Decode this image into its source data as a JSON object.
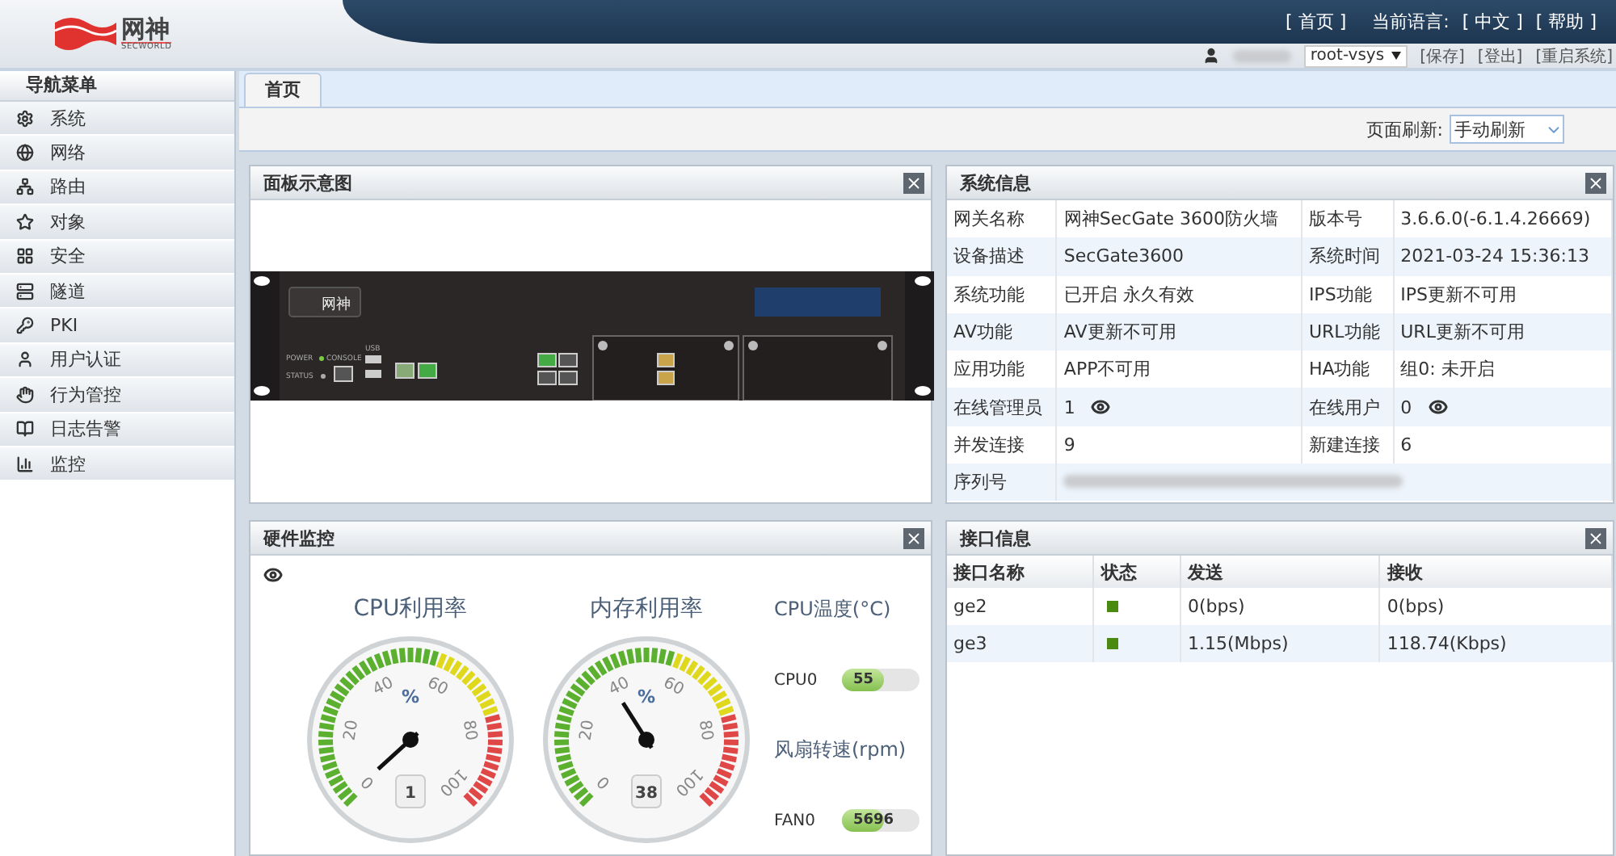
{
  "header": {
    "logo_text": "网神",
    "logo_subtext": "SECWORLD",
    "home_link": "[ 首页 ]",
    "language_label": "当前语言:",
    "language_link": "[ 中文 ]",
    "help_link": "[ 帮助 ]",
    "vsys": "root-vsys",
    "actions": [
      "[保存]",
      "[登出]",
      "[重启系统]"
    ]
  },
  "nav": {
    "title": "导航菜单",
    "items": [
      {
        "label": "系统"
      },
      {
        "label": "网络"
      },
      {
        "label": "路由"
      },
      {
        "label": "对象"
      },
      {
        "label": "安全"
      },
      {
        "label": "隧道"
      },
      {
        "label": "PKI"
      },
      {
        "label": "用户认证"
      },
      {
        "label": "行为管控"
      },
      {
        "label": "日志告警"
      },
      {
        "label": "监控"
      }
    ]
  },
  "tabs": [
    {
      "label": "首页",
      "selected": true
    }
  ],
  "refresh": {
    "label": "页面刷新:",
    "value": "手动刷新"
  },
  "panel_view": {
    "title": "面板示意图",
    "device_logo": "网神",
    "port_labels": [
      "POWER",
      "CONSOLE",
      "USB",
      "STATUS"
    ]
  },
  "system_info": {
    "title": "系统信息",
    "rows": [
      {
        "label": "网关名称",
        "value": "网神SecGate 3600防火墙",
        "label_2": "版本号",
        "value_2": "3.6.6.0(-6.1.4.26669)"
      },
      {
        "label": "设备描述",
        "value": "SecGate3600",
        "label_2": "系统时间",
        "value_2": "2021-03-24 15:36:13"
      },
      {
        "label": "系统功能",
        "value": "已开启 永久有效",
        "label_2": "IPS功能",
        "value_2": "IPS更新不可用"
      },
      {
        "label": "AV功能",
        "value": "AV更新不可用",
        "label_2": "URL功能",
        "value_2": "URL更新不可用"
      },
      {
        "label": "应用功能",
        "value": "APP不可用",
        "label_2": "HA功能",
        "value_2": "组0: 未开启"
      },
      {
        "label": "在线管理员",
        "value": "1",
        "kind": "viewable",
        "label_2": "在线用户",
        "value_2": "0"
      },
      {
        "label": "并发连接",
        "value": "9",
        "label_2": "新建连接",
        "value_2": "6"
      },
      {
        "label": "序列号",
        "kind": "redacted"
      }
    ]
  },
  "hardware": {
    "title": "硬件监控",
    "gauges": [
      {
        "title": "CPU利用率",
        "unit": "%",
        "scale": [
          "0",
          "20",
          "40",
          "60",
          "80",
          "100"
        ],
        "reading": "1"
      },
      {
        "title": "内存利用率",
        "unit": "%",
        "scale": [
          "0",
          "20",
          "40",
          "60",
          "80",
          "100"
        ],
        "reading": "38"
      }
    ],
    "groups": [
      {
        "title": "CPU温度(°C)",
        "bars": [
          {
            "name": "CPU0",
            "level": 0.55,
            "reading": "55"
          }
        ]
      },
      {
        "title": "风扇转速(rpm)",
        "bars": [
          {
            "name": "FAN0",
            "level": 0.55,
            "reading": "5696"
          }
        ]
      }
    ]
  },
  "interfaces": {
    "title": "接口信息",
    "columns": [
      "接口名称",
      "状态",
      "发送",
      "接收"
    ],
    "rows": [
      {
        "name": "ge2",
        "color": "#4a8a10",
        "sent": "0(bps)",
        "received": "0(bps)"
      },
      {
        "name": "ge3",
        "color": "#4a8a10",
        "sent": "1.15(Mbps)",
        "received": "118.74(Kbps)"
      }
    ]
  }
}
